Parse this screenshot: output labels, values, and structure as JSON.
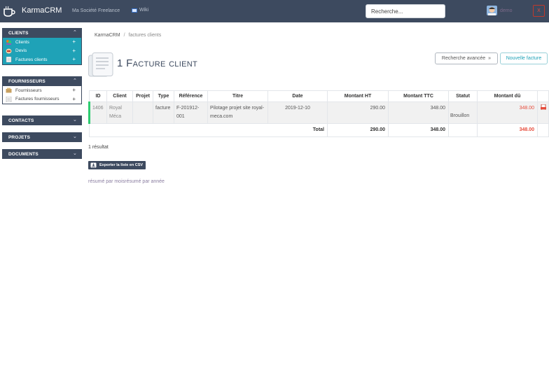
{
  "header": {
    "app_title": "KarmaCRM",
    "company": "Ma Société Freelance",
    "wiki": "Wiki",
    "search_placeholder": "Recherche...",
    "user": "demo",
    "logout": "X"
  },
  "sidebar": {
    "clients": {
      "title": "CLIENTS",
      "items": [
        {
          "label": "Clients",
          "action": "+"
        },
        {
          "label": "Devis",
          "action": "+"
        },
        {
          "label": "Factures clients",
          "action": "+"
        }
      ]
    },
    "fournisseurs": {
      "title": "FOURNISSEURS",
      "items": [
        {
          "label": "Fournisseurs",
          "action": "+"
        },
        {
          "label": "Factures fournisseurs",
          "action": "+"
        }
      ]
    },
    "contacts": {
      "title": "CONTACTS"
    },
    "projets": {
      "title": "PROJETS"
    },
    "documents": {
      "title": "DOCUMENTS"
    }
  },
  "breadcrumb": {
    "home": "KarmaCRM",
    "separator": "/",
    "current": "factures clients"
  },
  "page": {
    "title": "1 Facture client",
    "advanced_search": "Recherche avancée",
    "advanced_search_icon": "double-chevron-down-icon",
    "new_invoice": "Nouvelle facture"
  },
  "table": {
    "columns": [
      "ID",
      "Client",
      "Projet",
      "Type",
      "Référence",
      "Titre",
      "Date",
      "Montant HT",
      "Montant TTC",
      "Statut",
      "Montant dû",
      ""
    ],
    "rows": [
      {
        "id": "1406",
        "client": "Royal Méca",
        "projet": "",
        "type": "facture",
        "reference": "F-201912-001",
        "titre": "Pilotage projet site royal-meca.com",
        "date": "2019-12-10",
        "montant_ht": "290.00",
        "montant_ttc": "348.00",
        "statut": "Brouillon",
        "montant_du": "348.00"
      }
    ],
    "total": {
      "label": "Total",
      "ht": "290.00",
      "ttc": "348.00",
      "du": "348.00"
    }
  },
  "results": {
    "count_text": "1 résultat",
    "export_csv": "Exporter la liste en CSV"
  },
  "summary": {
    "by_month": "résumé par mois",
    "by_year": "résumé par année"
  },
  "colors": {
    "navbar": "#3d4a5f",
    "accent": "#1fa2b7",
    "due": "#e74c3c",
    "row_marker": "#2ecc71"
  }
}
